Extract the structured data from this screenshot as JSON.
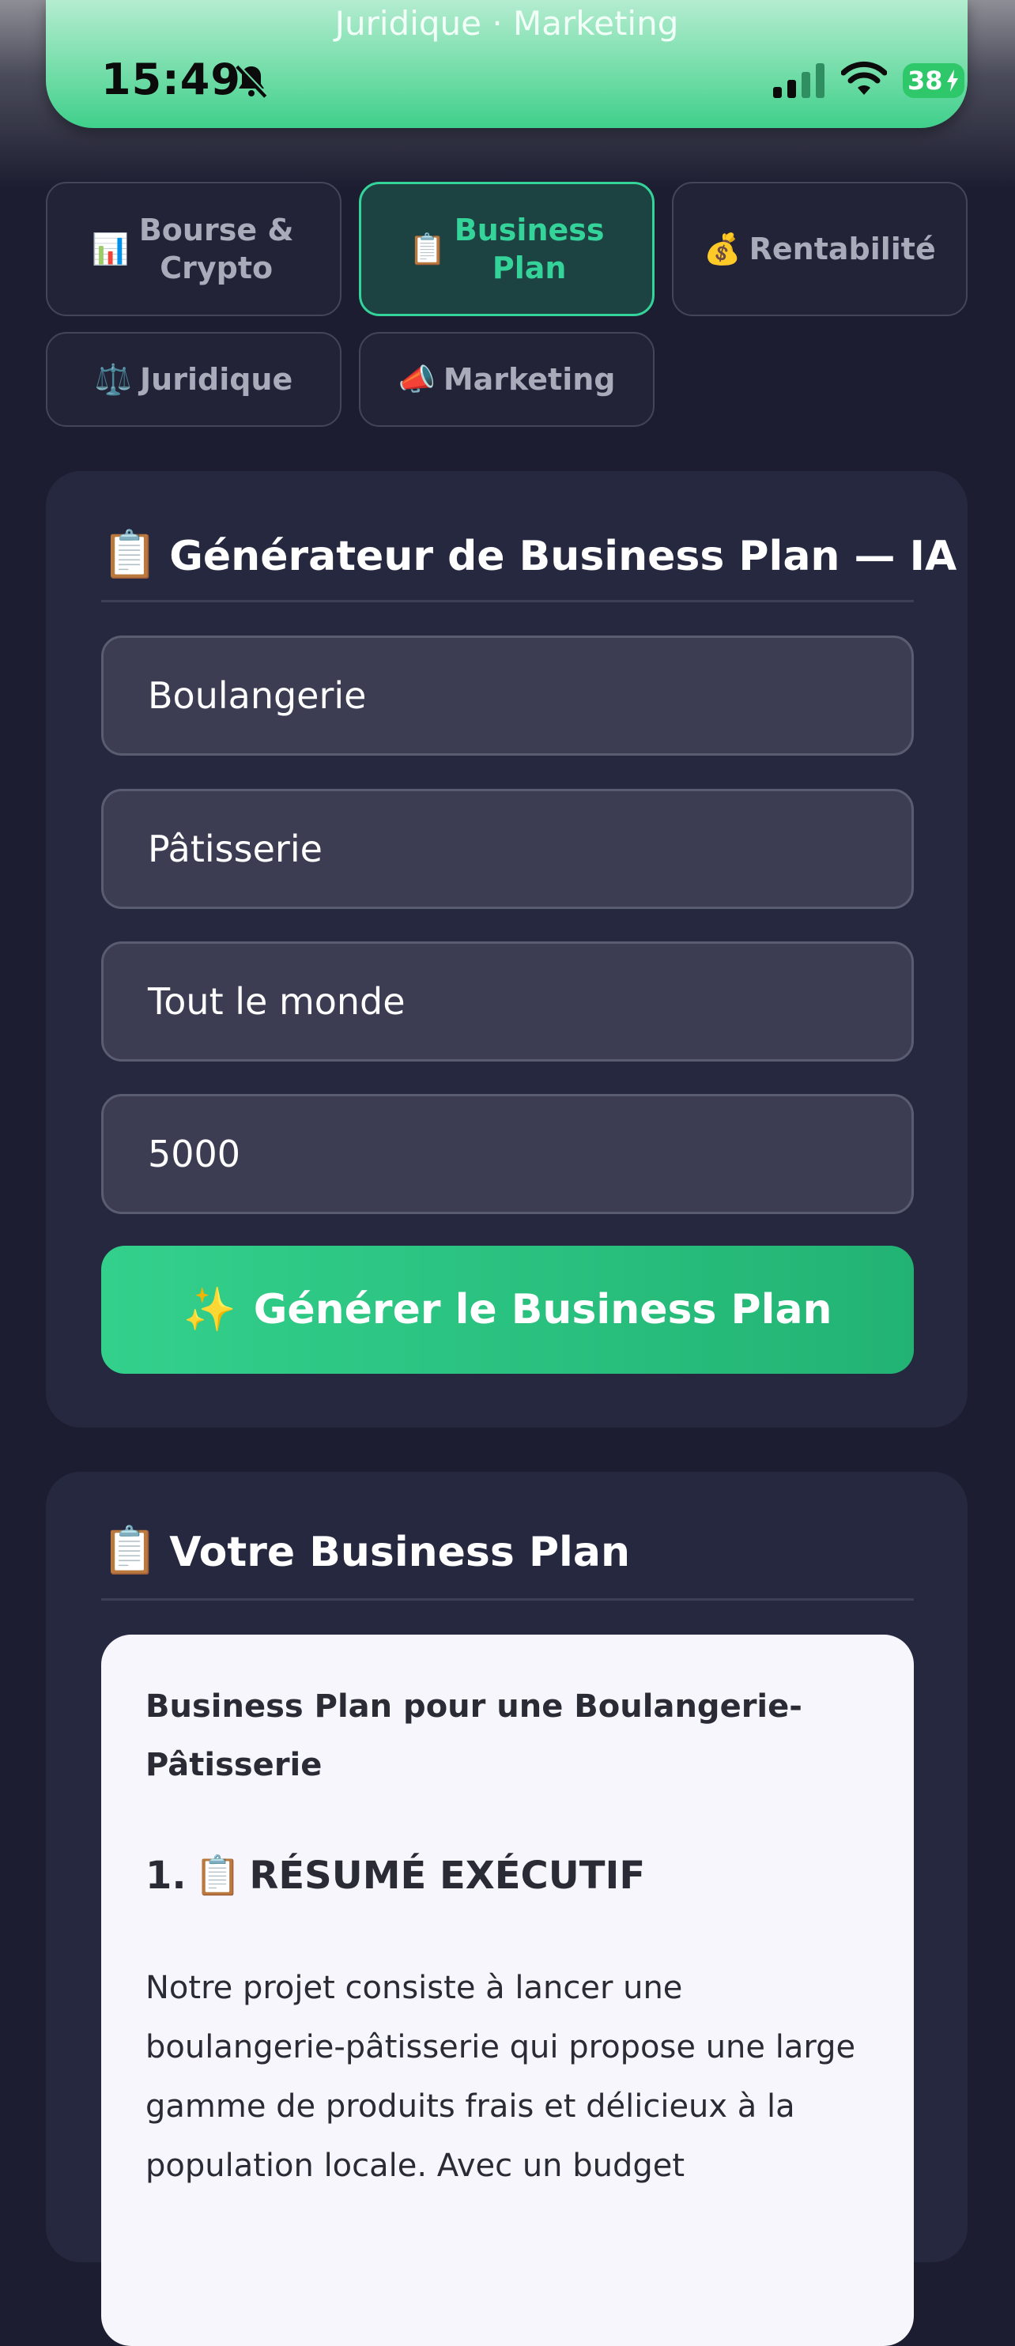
{
  "status_bar": {
    "subtitle": "Juridique · Marketing",
    "time": "15:49",
    "battery": "38"
  },
  "tabs": [
    {
      "icon": "📊",
      "label": "Bourse & Crypto",
      "active": false
    },
    {
      "icon": "📋",
      "label": "Business Plan",
      "active": true
    },
    {
      "icon": "💰",
      "label": "Rentabilité",
      "active": false
    },
    {
      "icon": "⚖️",
      "label": "Juridique",
      "active": false
    },
    {
      "icon": "📣",
      "label": "Marketing",
      "active": false
    }
  ],
  "generator": {
    "icon": "📋",
    "title": "Générateur de Business Plan — IA",
    "fields": [
      "Boulangerie",
      "Pâtisserie",
      "Tout le monde",
      "5000"
    ],
    "button_icon": "✨",
    "button_label": "Générer le Business Plan"
  },
  "result": {
    "icon": "📋",
    "title": "Votre Business Plan",
    "heading": "Business Plan pour une Boulangerie-Pâtisserie",
    "section_number": "1.",
    "section_icon": "📋",
    "section_title": "RÉSUMÉ EXÉCUTIF",
    "paragraph": "Notre projet consiste à lancer une boulangerie-pâtisserie qui propose une large gamme de produits frais et délicieux à la population locale. Avec un budget"
  },
  "colors": {
    "background": "#1c1d30",
    "accent": "#34d399",
    "card": "#262840",
    "field": "#3c3d53"
  }
}
